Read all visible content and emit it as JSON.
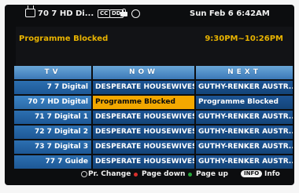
{
  "topbar": {
    "channel_info": "70 7 HD Di...",
    "badge_cc": "CC",
    "badge_sub": "DD",
    "date_time": "Sun Feb 6  6:42AM"
  },
  "info": {
    "programme_title": "Programme Blocked",
    "programme_time": "9:30PM~10:26PM"
  },
  "guide": {
    "headers": [
      "TV",
      "NOW",
      "NEXT"
    ],
    "rows": [
      {
        "channel": "7  7 Digital",
        "now": "DESPERATE HOUSEWIVES",
        "next": "GUTHY-RENKER AUSTR..."
      },
      {
        "channel": "70  7 HD Digital",
        "now": "Programme Blocked",
        "next": "Programme Blocked"
      },
      {
        "channel": "71  7 Digital 1",
        "now": "DESPERATE HOUSEWIVES",
        "next": "GUTHY-RENKER AUSTR..."
      },
      {
        "channel": "72  7 Digital 2",
        "now": "DESPERATE HOUSEWIVES",
        "next": "GUTHY-RENKER AUSTR..."
      },
      {
        "channel": "73  7 Digital 3",
        "now": "DESPERATE HOUSEWIVES",
        "next": "GUTHY-RENKER AUSTR..."
      },
      {
        "channel": "77  7 Guide",
        "now": "DESPERATE HOUSEWIVES",
        "next": "GUTHY-RENKER AUSTR..."
      }
    ],
    "selected_row": 1
  },
  "footer": {
    "pr_change": "Pr. Change",
    "page_down": "Page down",
    "page_up": "Page up",
    "info_key": "INFO",
    "info_label": "Info",
    "page_down_color": "#d9302b",
    "page_up_color": "#27a83a"
  }
}
